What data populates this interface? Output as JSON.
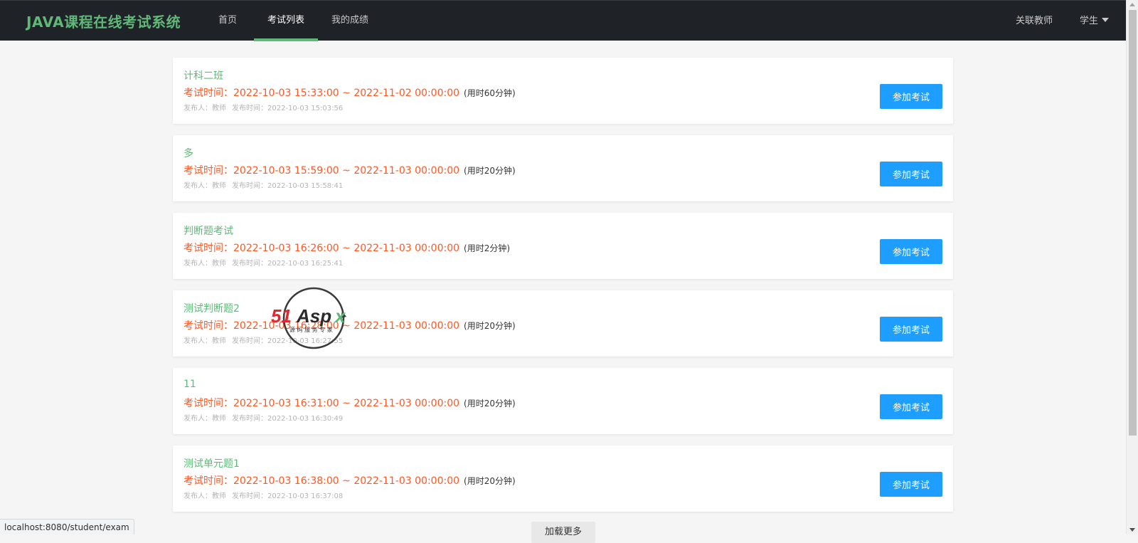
{
  "navbar": {
    "brand": "JAVA课程在线考试系统",
    "items": [
      {
        "label": "首页"
      },
      {
        "label": "考试列表"
      },
      {
        "label": "我的成绩"
      }
    ],
    "active_index": 1,
    "right": {
      "teacher_link": "关联教师",
      "user_menu": "学生"
    }
  },
  "exams": [
    {
      "title": "计科二班",
      "time_label": "考试时间：",
      "time_range": "2022-10-03 15:33:00 ~ 2022-11-02 00:00:00",
      "duration": "(用时60分钟)",
      "publisher": "发布人：教师",
      "publish_time": "发布时间：2022-10-03 15:03:56",
      "button": "参加考试"
    },
    {
      "title": "多",
      "time_label": "考试时间：",
      "time_range": "2022-10-03 15:59:00 ~ 2022-11-03 00:00:00",
      "duration": "(用时20分钟)",
      "publisher": "发布人：教师",
      "publish_time": "发布时间：2022-10-03 15:58:41",
      "button": "参加考试"
    },
    {
      "title": "判断题考试",
      "time_label": "考试时间：",
      "time_range": "2022-10-03 16:26:00 ~ 2022-11-03 00:00:00",
      "duration": "(用时2分钟)",
      "publisher": "发布人：教师",
      "publish_time": "发布时间：2022-10-03 16:25:41",
      "button": "参加考试"
    },
    {
      "title": "测试判断题2",
      "time_label": "考试时间：",
      "time_range": "2022-10-03 16:28:00 ~ 2022-11-03 00:00:00",
      "duration": "(用时20分钟)",
      "publisher": "发布人：教师",
      "publish_time": "发布时间：2022-10-03 16:27:55",
      "button": "参加考试"
    },
    {
      "title": "11",
      "time_label": "考试时间：",
      "time_range": "2022-10-03 16:31:00 ~ 2022-11-03 00:00:00",
      "duration": "(用时20分钟)",
      "publisher": "发布人：教师",
      "publish_time": "发布时间：2022-10-03 16:30:49",
      "button": "参加考试"
    },
    {
      "title": "测试单元题1",
      "time_label": "考试时间：",
      "time_range": "2022-10-03 16:38:00 ~ 2022-11-03 00:00:00",
      "duration": "(用时20分钟)",
      "publisher": "发布人：教师",
      "publish_time": "发布时间：2022-10-03 16:37:08",
      "button": "参加考试"
    }
  ],
  "load_more": "加载更多",
  "status_url": "localhost:8080/student/exam",
  "watermark": {
    "logo_text": "51Aspx",
    "tagline": "源码服务专家"
  },
  "colors": {
    "navbar_bg": "#1f2227",
    "brand_green": "#5fb878",
    "time_orange": "#ff5722",
    "button_blue": "#1e9fff",
    "page_bg": "#f5f5f5"
  }
}
